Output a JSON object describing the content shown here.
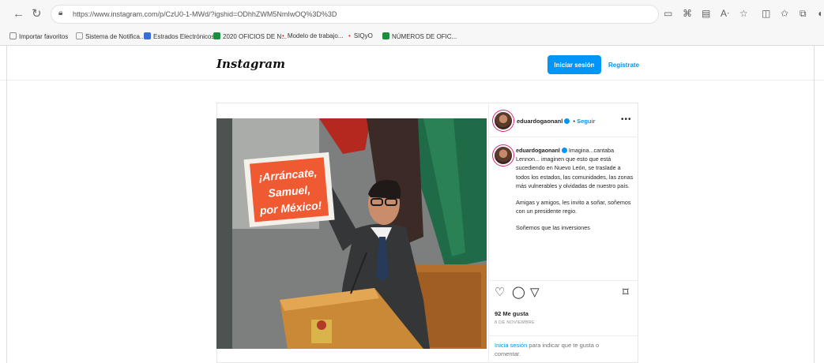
{
  "browser": {
    "url": "https://www.instagram.com/p/CzU0-1-MWd/?igshid=ODhhZWM5NmIwOQ%3D%3D",
    "bookmarks": [
      {
        "label": "Importar favoritos",
        "icon": "folder-icon",
        "color": "#8a8a8a"
      },
      {
        "label": "Sistema de Notifica...",
        "icon": "page-icon",
        "color": "#9a9a9a"
      },
      {
        "label": "Estrados Electrónicos",
        "icon": "document-icon",
        "color": "#3b6fd4"
      },
      {
        "label": "2020 OFICIOS DE N...",
        "icon": "sheets-icon",
        "color": "#1e8e3e"
      },
      {
        "label": "Modelo de trabajo...",
        "icon": "dot-icon",
        "color": "#d93025"
      },
      {
        "label": "SIQyO",
        "icon": "dot-icon",
        "color": "#d93025"
      },
      {
        "label": "NÚMEROS DE OFIC...",
        "icon": "sheets-icon",
        "color": "#1e8e3e"
      }
    ]
  },
  "header": {
    "logo": "Instagram",
    "login_label": "Iniciar sesión",
    "signup_label": "Regístrate"
  },
  "post": {
    "username": "eduardogaonanl",
    "follow_label": "Seguir",
    "sign_text": {
      "line1": "¡Arráncate,",
      "line2": "Samuel,",
      "line3": "por México!"
    },
    "caption_p1": "Imagina...cantaba Lennon... imaginen que esto que está sucediendo en Nuevo León, se traslade a todos los estados, las comunidades, las zonas más vulnerables y olvidadas de nuestro país.",
    "caption_p2": "Amigas y amigos, les invito a soñar, soñemos con un presidente regio.",
    "caption_p3": "Soñemos que las inversiones",
    "likes": "92 Me gusta",
    "date": "8 DE NOVIEMBRE",
    "login_link": "Inicia sesión",
    "login_hint": " para indicar que te gusta o comentar."
  }
}
